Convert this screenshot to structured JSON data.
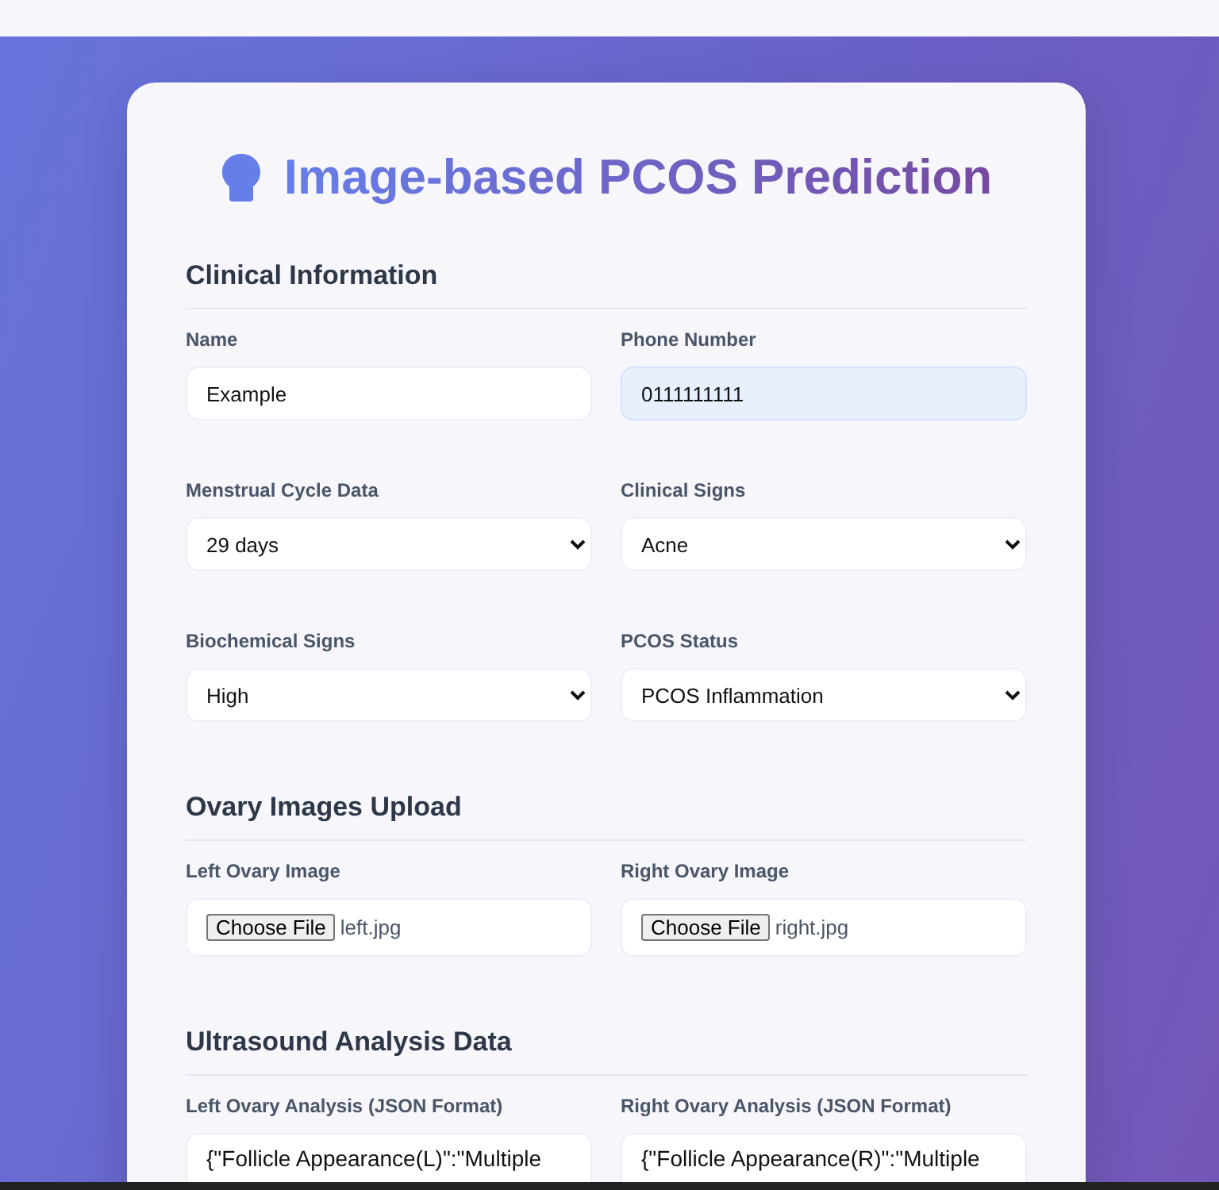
{
  "title": "Image-based PCOS Prediction",
  "sections": [
    {
      "heading": "Clinical Information",
      "fields": [
        {
          "kind": "text",
          "label": "Name",
          "value": "Example",
          "highlighted": false
        },
        {
          "kind": "text",
          "label": "Phone Number",
          "value": "0111111111",
          "highlighted": true
        },
        {
          "kind": "select",
          "label": "Menstrual Cycle Data",
          "value": "29 days"
        },
        {
          "kind": "select",
          "label": "Clinical Signs",
          "value": "Acne"
        },
        {
          "kind": "select",
          "label": "Biochemical Signs",
          "value": "High"
        },
        {
          "kind": "select",
          "label": "PCOS Status",
          "value": "PCOS Inflammation"
        }
      ]
    },
    {
      "heading": "Ovary Images Upload",
      "fields": [
        {
          "kind": "file",
          "label": "Left Ovary Image",
          "button": "Choose File",
          "value": "left.jpg"
        },
        {
          "kind": "file",
          "label": "Right Ovary Image",
          "button": "Choose File",
          "value": "right.jpg"
        }
      ]
    },
    {
      "heading": "Ultrasound Analysis Data",
      "fields": [
        {
          "kind": "textarea",
          "label": "Left Ovary Analysis (JSON Format)",
          "value": "{\"Follicle Appearance(L)\":\"Multiple"
        },
        {
          "kind": "textarea",
          "label": "Right Ovary Analysis (JSON Format)",
          "value": "{\"Follicle Appearance(R)\":\"Multiple"
        }
      ]
    }
  ]
}
